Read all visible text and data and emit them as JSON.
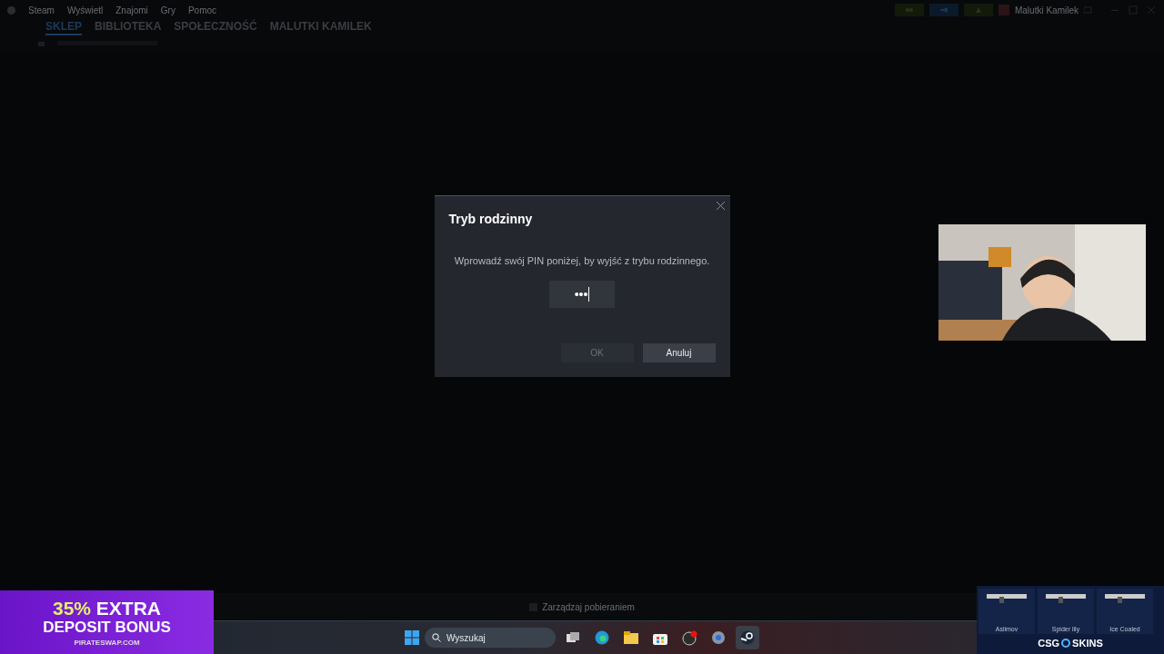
{
  "menu": [
    "Steam",
    "Wyświetl",
    "Znajomi",
    "Gry",
    "Pomoc"
  ],
  "nav_tabs": [
    {
      "label": "SKLEP",
      "selected": true
    },
    {
      "label": "BIBLIOTEKA",
      "selected": false
    },
    {
      "label": "SPOŁECZNOŚĆ",
      "selected": false
    },
    {
      "label": "MALUTKI KAMILEK",
      "selected": false
    }
  ],
  "account": {
    "name": "Malutki Kamilek"
  },
  "dialog": {
    "title": "Tryb rodzinny",
    "message": "Wprowadź swój PIN poniżej, by wyjść z trybu rodzinnego.",
    "pin_field": {
      "value": "•••"
    },
    "buttons": [
      {
        "label": "OK",
        "disabled": true
      },
      {
        "label": "Anuluj",
        "disabled": false
      }
    ]
  },
  "download_bar": {
    "label": "Zarządzaj pobieraniem"
  },
  "taskbar": {
    "search_placeholder": "Wyszukaj",
    "apps": [
      {
        "kind": "taskview",
        "active": false
      },
      {
        "kind": "edge",
        "active": false
      },
      {
        "kind": "folder",
        "active": false
      },
      {
        "kind": "store",
        "active": false
      },
      {
        "kind": "obs",
        "active": false
      },
      {
        "kind": "settings",
        "active": false
      },
      {
        "kind": "steam",
        "active": true
      }
    ]
  },
  "ad_left": {
    "highlight": "35%",
    "headline": "EXTRA",
    "subline": "DEPOSIT BONUS",
    "site": "PIRATESWAP.COM"
  },
  "ad_right": {
    "skins": [
      "Asiimov",
      "Spider lily",
      "Ice Coaled"
    ],
    "brand_left": "CSG",
    "brand_right": "SKINS"
  }
}
